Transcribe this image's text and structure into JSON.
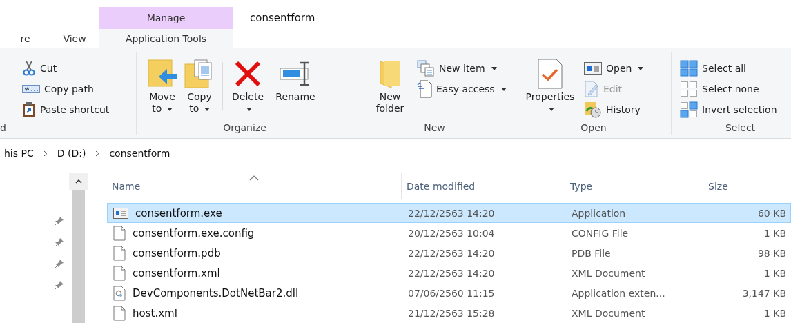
{
  "window": {
    "title": "consentform"
  },
  "context_tab_header": "Manage",
  "tabs": [
    {
      "label": "re",
      "selected": false
    },
    {
      "label": "View",
      "selected": false
    },
    {
      "label": "Application Tools",
      "selected": true
    }
  ],
  "ribbon": {
    "groups": [
      {
        "label": "d",
        "items": [
          {
            "kind": "small",
            "label": "Cut",
            "dropdown": false,
            "disabled": false
          },
          {
            "kind": "small",
            "label": "Copy path",
            "dropdown": false,
            "disabled": false
          },
          {
            "kind": "small",
            "label": "Paste shortcut",
            "dropdown": false,
            "disabled": false
          }
        ]
      },
      {
        "label": "Organize",
        "items": [
          {
            "kind": "large",
            "label": "Move to",
            "dropdown": true,
            "disabled": false
          },
          {
            "kind": "large",
            "label": "Copy to",
            "dropdown": true,
            "disabled": false
          },
          {
            "kind": "separator"
          },
          {
            "kind": "large",
            "label": "Delete",
            "dropdown": true,
            "disabled": false
          },
          {
            "kind": "large",
            "label": "Rename",
            "dropdown": false,
            "disabled": false
          }
        ]
      },
      {
        "label": "New",
        "items": [
          {
            "kind": "large",
            "label": "New folder",
            "dropdown": false,
            "disabled": false
          },
          {
            "kind": "column",
            "items": [
              {
                "kind": "small",
                "label": "New item",
                "dropdown": true,
                "disabled": false
              },
              {
                "kind": "small",
                "label": "Easy access",
                "dropdown": true,
                "disabled": false
              }
            ]
          }
        ]
      },
      {
        "label": "Open",
        "items": [
          {
            "kind": "large",
            "label": "Properties",
            "dropdown": true,
            "disabled": false
          },
          {
            "kind": "column",
            "items": [
              {
                "kind": "small",
                "label": "Open",
                "dropdown": true,
                "disabled": false
              },
              {
                "kind": "small",
                "label": "Edit",
                "dropdown": false,
                "disabled": true
              },
              {
                "kind": "small",
                "label": "History",
                "dropdown": false,
                "disabled": false
              }
            ]
          }
        ]
      },
      {
        "label": "Select",
        "items": [
          {
            "kind": "small",
            "label": "Select all",
            "dropdown": false,
            "disabled": false
          },
          {
            "kind": "small",
            "label": "Select none",
            "dropdown": false,
            "disabled": false
          },
          {
            "kind": "small",
            "label": "Invert selection",
            "dropdown": false,
            "disabled": false
          }
        ]
      }
    ]
  },
  "breadcrumb": [
    "his PC",
    "D (D:)",
    "consentform"
  ],
  "file_list": {
    "columns": [
      {
        "label": "Name",
        "sorted": true
      },
      {
        "label": "Date modified",
        "sorted": false
      },
      {
        "label": "Type",
        "sorted": false
      },
      {
        "label": "Size",
        "sorted": false
      }
    ],
    "rows": [
      {
        "kind": "application",
        "name": "consentform.exe",
        "date": "22/12/2563 14:20",
        "type": "Application",
        "size": "60 KB",
        "selected": true
      },
      {
        "kind": "file",
        "name": "consentform.exe.config",
        "date": "20/12/2563 10:04",
        "type": "CONFIG File",
        "size": "1 KB",
        "selected": false
      },
      {
        "kind": "file",
        "name": "consentform.pdb",
        "date": "22/12/2563 14:20",
        "type": "PDB File",
        "size": "98 KB",
        "selected": false
      },
      {
        "kind": "file",
        "name": "consentform.xml",
        "date": "22/12/2563 14:20",
        "type": "XML Document",
        "size": "1 KB",
        "selected": false
      },
      {
        "kind": "dll",
        "name": "DevComponents.DotNetBar2.dll",
        "date": "07/06/2560 11:15",
        "type": "Application exten...",
        "size": "3,147 KB",
        "selected": false
      },
      {
        "kind": "file",
        "name": "host.xml",
        "date": "21/12/2563 15:28",
        "type": "XML Document",
        "size": "1 KB",
        "selected": false
      }
    ]
  }
}
